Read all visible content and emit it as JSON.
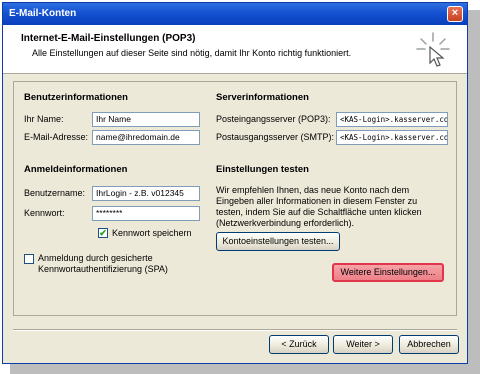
{
  "window": {
    "title": "E-Mail-Konten",
    "close_icon": "×"
  },
  "header": {
    "title": "Internet-E-Mail-Einstellungen (POP3)",
    "subtitle": "Alle Einstellungen auf dieser Seite sind nötig, damit Ihr Konto richtig funktioniert."
  },
  "user_info": {
    "heading": "Benutzerinformationen",
    "name_label": "Ihr Name:",
    "name_value": "Ihr Name",
    "email_label": "E-Mail-Adresse:",
    "email_value": "name@ihredomain.de"
  },
  "server_info": {
    "heading": "Serverinformationen",
    "incoming_label": "Posteingangsserver (POP3):",
    "incoming_value": "<KAS-Login>.kasserver.com",
    "outgoing_label": "Postausgangsserver (SMTP):",
    "outgoing_value": "<KAS-Login>.kasserver.com"
  },
  "logon_info": {
    "heading": "Anmeldeinformationen",
    "username_label": "Benutzername:",
    "username_value": "IhrLogin - z.B. v012345",
    "password_label": "Kennwort:",
    "password_value": "********",
    "remember_label": "Kennwort speichern",
    "remember_checked": true,
    "spa_label_line1": "Anmeldung durch gesicherte",
    "spa_label_line2": "Kennwortauthentifizierung (SPA)",
    "spa_checked": false
  },
  "test_settings": {
    "heading": "Einstellungen testen",
    "description": "Wir empfehlen Ihnen, das neue Konto nach dem\nEingeben aller Informationen in diesem Fenster zu\ntesten, indem Sie auf die Schaltfläche unten klicken\n(Netzwerkverbindung erforderlich).",
    "test_button": "Kontoeinstellungen testen...",
    "more_button": "Weitere Einstellungen..."
  },
  "footer": {
    "back_button": "< Zurück",
    "next_button": "Weiter >",
    "cancel_button": "Abbrechen"
  },
  "colors": {
    "titlebar": "#1452d1",
    "highlight_border": "#e0364c",
    "highlight_fill": "#ee8088",
    "checkmark": "#21a121"
  },
  "icons": {
    "header_icon": "wizard-sparkle-icon"
  }
}
